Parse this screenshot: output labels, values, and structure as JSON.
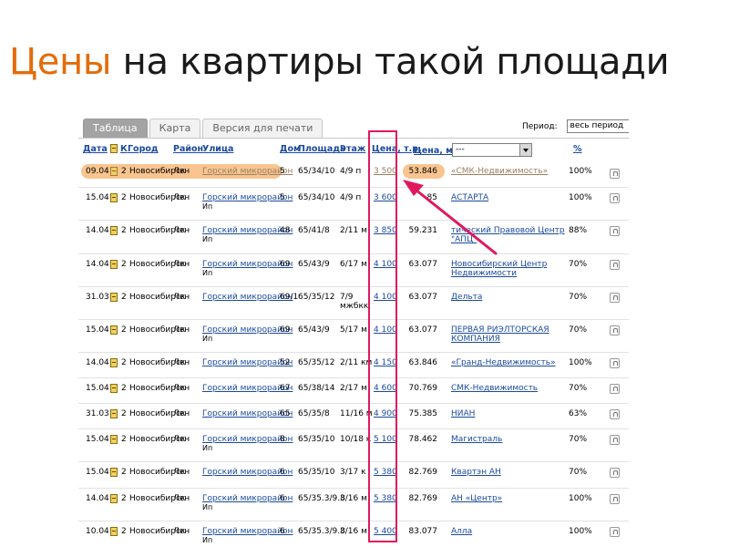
{
  "slide": {
    "title_accent": "Цены",
    "title_rest": "на квартиры такой площади"
  },
  "tabs": [
    {
      "label": "Таблица",
      "active": true
    },
    {
      "label": "Карта",
      "active": false
    },
    {
      "label": "Версия для печати",
      "active": false
    }
  ],
  "period": {
    "label": "Период:",
    "value": "весь период"
  },
  "columns": {
    "date": "Дата",
    "rooms": "К",
    "city": "Город",
    "district": "Район",
    "street": "Улица",
    "house": "Дом",
    "area": "Площадь",
    "floor": "Этаж",
    "price": "Цена, т.р.",
    "price_m2": "Цена, м",
    "price_m2_sup": "2",
    "agency_filter": "---",
    "pct": "%"
  },
  "rows": [
    {
      "date": "09.04",
      "rooms": "2",
      "city": "Новосибирск",
      "district": "Лен",
      "street": "Горский микрорайон",
      "street_sub": "",
      "house": "5",
      "area": "65/34/10",
      "floor": "4/9 п",
      "price": "3 500",
      "price_m2": "53.846",
      "agency": "«СМК-Недвижимость»",
      "pct": "100%",
      "highlight": true
    },
    {
      "date": "15.04",
      "rooms": "2",
      "city": "Новосибирск",
      "district": "Лен",
      "street": "Горский микрорайон",
      "street_sub": "Ип",
      "house": "5",
      "area": "65/34/10",
      "floor": "4/9 п",
      "price": "3 600",
      "price_m2": "85",
      "agency": "АСТАРТА",
      "pct": "100%",
      "highlight": false
    },
    {
      "date": "14.04",
      "rooms": "2",
      "city": "Новосибирск",
      "district": "Лен",
      "street": "Горский микрорайон",
      "street_sub": "Ип",
      "house": "48",
      "area": "65/41/8",
      "floor": "2/11 м",
      "price": "3 850",
      "price_m2": "59.231",
      "agency": "тический Правовой Центр \"АПЦ\"",
      "pct": "88%",
      "highlight": false
    },
    {
      "date": "14.04",
      "rooms": "2",
      "city": "Новосибирск",
      "district": "Лен",
      "street": "Горский микрорайон",
      "street_sub": "Ип",
      "house": "69",
      "area": "65/43/9",
      "floor": "6/17 м",
      "price": "4 100",
      "price_m2": "63.077",
      "agency": "Новосибирский Центр Недвижимости",
      "pct": "70%",
      "highlight": false
    },
    {
      "date": "31.03",
      "rooms": "2",
      "city": "Новосибирск",
      "district": "Лен",
      "street": "Горский микрорайон",
      "street_sub": "",
      "house": "69/1",
      "area": "65/35/12",
      "floor": "7/9 мжбкк",
      "price": "4 100",
      "price_m2": "63.077",
      "agency": "Дельта",
      "pct": "70%",
      "highlight": false
    },
    {
      "date": "15.04",
      "rooms": "2",
      "city": "Новосибирск",
      "district": "Лен",
      "street": "Горский микрорайон",
      "street_sub": "Ип",
      "house": "69",
      "area": "65/43/9",
      "floor": "5/17 м",
      "price": "4 100",
      "price_m2": "63.077",
      "agency": "ПЕРВАЯ РИЭЛТОРСКАЯ КОМПАНИЯ",
      "pct": "70%",
      "highlight": false
    },
    {
      "date": "14.04",
      "rooms": "2",
      "city": "Новосибирск",
      "district": "Лен",
      "street": "Горский микрорайон",
      "street_sub": "",
      "house": "52",
      "area": "65/35/12",
      "floor": "2/11 км",
      "price": "4 150",
      "price_m2": "63.846",
      "agency": "«Гранд-Недвижимость»",
      "pct": "100%",
      "highlight": false
    },
    {
      "date": "15.04",
      "rooms": "2",
      "city": "Новосибирск",
      "district": "Лен",
      "street": "Горский микрорайон",
      "street_sub": "",
      "house": "67",
      "area": "65/38/14",
      "floor": "2/17 м",
      "price": "4 600",
      "price_m2": "70.769",
      "agency": "СМК-Недвижимость",
      "pct": "70%",
      "highlight": false
    },
    {
      "date": "31.03",
      "rooms": "2",
      "city": "Новосибирск",
      "district": "Лен",
      "street": "Горский микрорайон",
      "street_sub": "",
      "house": "65",
      "area": "65/35/8",
      "floor": "11/16 м",
      "price": "4 900",
      "price_m2": "75.385",
      "agency": "НИАН",
      "pct": "63%",
      "highlight": false
    },
    {
      "date": "15.04",
      "rooms": "2",
      "city": "Новосибирск",
      "district": "Лен",
      "street": "Горский микрорайон",
      "street_sub": "Ип",
      "house": "8",
      "area": "65/35/10",
      "floor": "10/18 к",
      "price": "5 100",
      "price_m2": "78.462",
      "agency": "Магистраль",
      "pct": "70%",
      "highlight": false
    },
    {
      "date": "15.04",
      "rooms": "2",
      "city": "Новосибирск",
      "district": "Лен",
      "street": "Горский микрорайон",
      "street_sub": "",
      "house": "6",
      "area": "65/35/10",
      "floor": "3/17 к",
      "price": "5 380",
      "price_m2": "82.769",
      "agency": "Квартэн АН",
      "pct": "70%",
      "highlight": false
    },
    {
      "date": "14.04",
      "rooms": "2",
      "city": "Новосибирск",
      "district": "Лен",
      "street": "Горский микрорайон",
      "street_sub": "Ип",
      "house": "6",
      "area": "65/35.3/9.8",
      "floor": "3/16 м",
      "price": "5 380",
      "price_m2": "82.769",
      "agency": "АН «Центр»",
      "pct": "100%",
      "highlight": false
    },
    {
      "date": "10.04",
      "rooms": "2",
      "city": "Новосибирск",
      "district": "Лен",
      "street": "Горский микрорайон",
      "street_sub": "Ип",
      "house": "6",
      "area": "65/35.3/9.8",
      "floor": "3/16 м",
      "price": "5 400",
      "price_m2": "83.077",
      "agency": "Алла",
      "pct": "100%",
      "highlight": false
    }
  ],
  "colors": {
    "accent": "#e46c0a",
    "link": "#1b4aa0",
    "highlight": "#f9c48f",
    "annotation": "#e0195f"
  },
  "icons": {
    "row_doc": "document-icon",
    "row_action": "bookmark-icon"
  }
}
